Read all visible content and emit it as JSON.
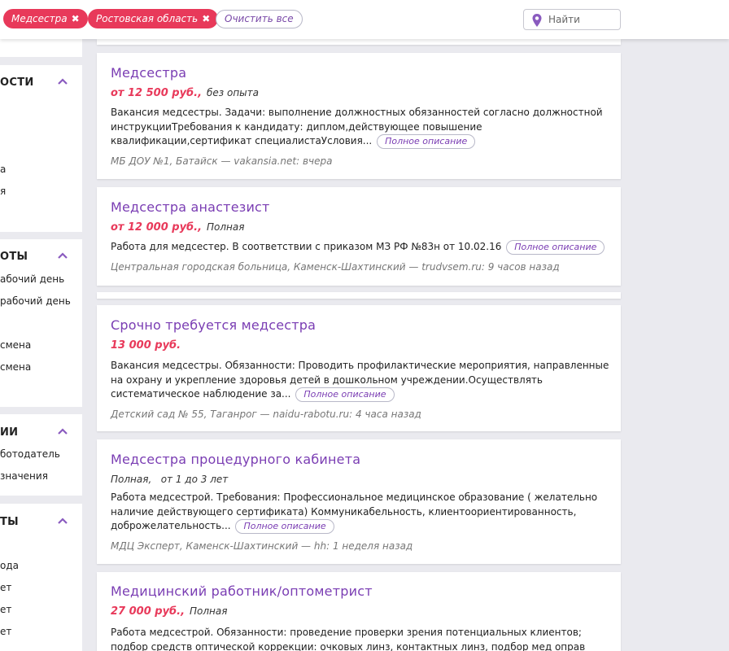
{
  "filters": {
    "chips": [
      {
        "label": "Медсестра",
        "remove": "✖"
      },
      {
        "label": "Ростовская область",
        "remove": "✖"
      }
    ],
    "clear_label": "Очистить все",
    "search_placeholder": "Найти",
    "search_icon": "map-pin-icon"
  },
  "sidebar": {
    "sections": [
      {
        "heading": "ОСТИ",
        "items": [
          "а",
          "я"
        ]
      },
      {
        "heading": "ОТЫ",
        "items": [
          "абочий день",
          "рабочий день",
          "смена",
          "смена"
        ]
      },
      {
        "heading": "ИИ",
        "items": [
          "ботодатель",
          "значения"
        ]
      },
      {
        "heading": "ТЫ",
        "items": [
          "ода",
          "ет",
          "ет",
          "ет"
        ]
      }
    ]
  },
  "jobs": [
    {
      "title": "Медсестра",
      "salary": "от 12 500 руб.,",
      "conditions": "без опыта",
      "description": "Вакансия медсестры. Задачи: выполнение должностных обязанностей согласно должностной инструкцииТребования к кандидату: диплом,действующее повышение квалификации,сертификат специалистаУсловия...",
      "more_label": "Полное описание",
      "source": "МБ ДОУ №1, Батайск — vakansia.net: вчера"
    },
    {
      "title": "Медсестра анастезист",
      "salary": "от 12 000 руб.,",
      "conditions": "Полная",
      "description": "Работа для медсестер. В соответствии с приказом МЗ РФ №83н от 10.02.16",
      "more_label": "Полное описание",
      "source": "Центральная городская больница, Каменск-Шахтинский — trudvsem.ru: 9 часов назад"
    },
    {
      "title": "Срочно требуется медсестра",
      "salary": "13 000 руб.",
      "conditions": "",
      "description": "Вакансия медсестры. Обязанности: Проводить профилактические мероприятия, направленные на охрану и укрепление здоровья детей в дошкольном учреждении.Осуществлять систематическое наблюдение за...",
      "more_label": "Полное описание",
      "source": "Детский сад № 55, Таганрог — naidu-rabotu.ru: 4 часа назад"
    },
    {
      "title": "Медсестра процедурного кабинета",
      "salary": "",
      "conditions": "Полная,   от 1 до 3 лет",
      "description": "Работа медсестрой. Требования: Профессиональное медицинское образование ( желательно наличие действующего сертификата) Коммуникабельность, клиентоориентированность, доброжелательность...",
      "more_label": "Полное описание",
      "source": "МДЦ Эксперт, Каменск-Шахтинский — hh: 1 неделя назад"
    },
    {
      "title": "Медицинский работник/оптометрист",
      "salary": "27 000 руб.,",
      "conditions": "Полная",
      "description": "Работа медсестрой. Обязанности: проведение проверки зрения потенциальных клиентов; подбор средств оптической коррекции: очковых линз, контактных линз, подбор мед оправ клиенту; работа с...",
      "more_label": "",
      "source": ""
    }
  ],
  "colors": {
    "accent_purple": "#7a3db3",
    "chip_red": "#e8395a",
    "salary_red": "#e8395a"
  }
}
